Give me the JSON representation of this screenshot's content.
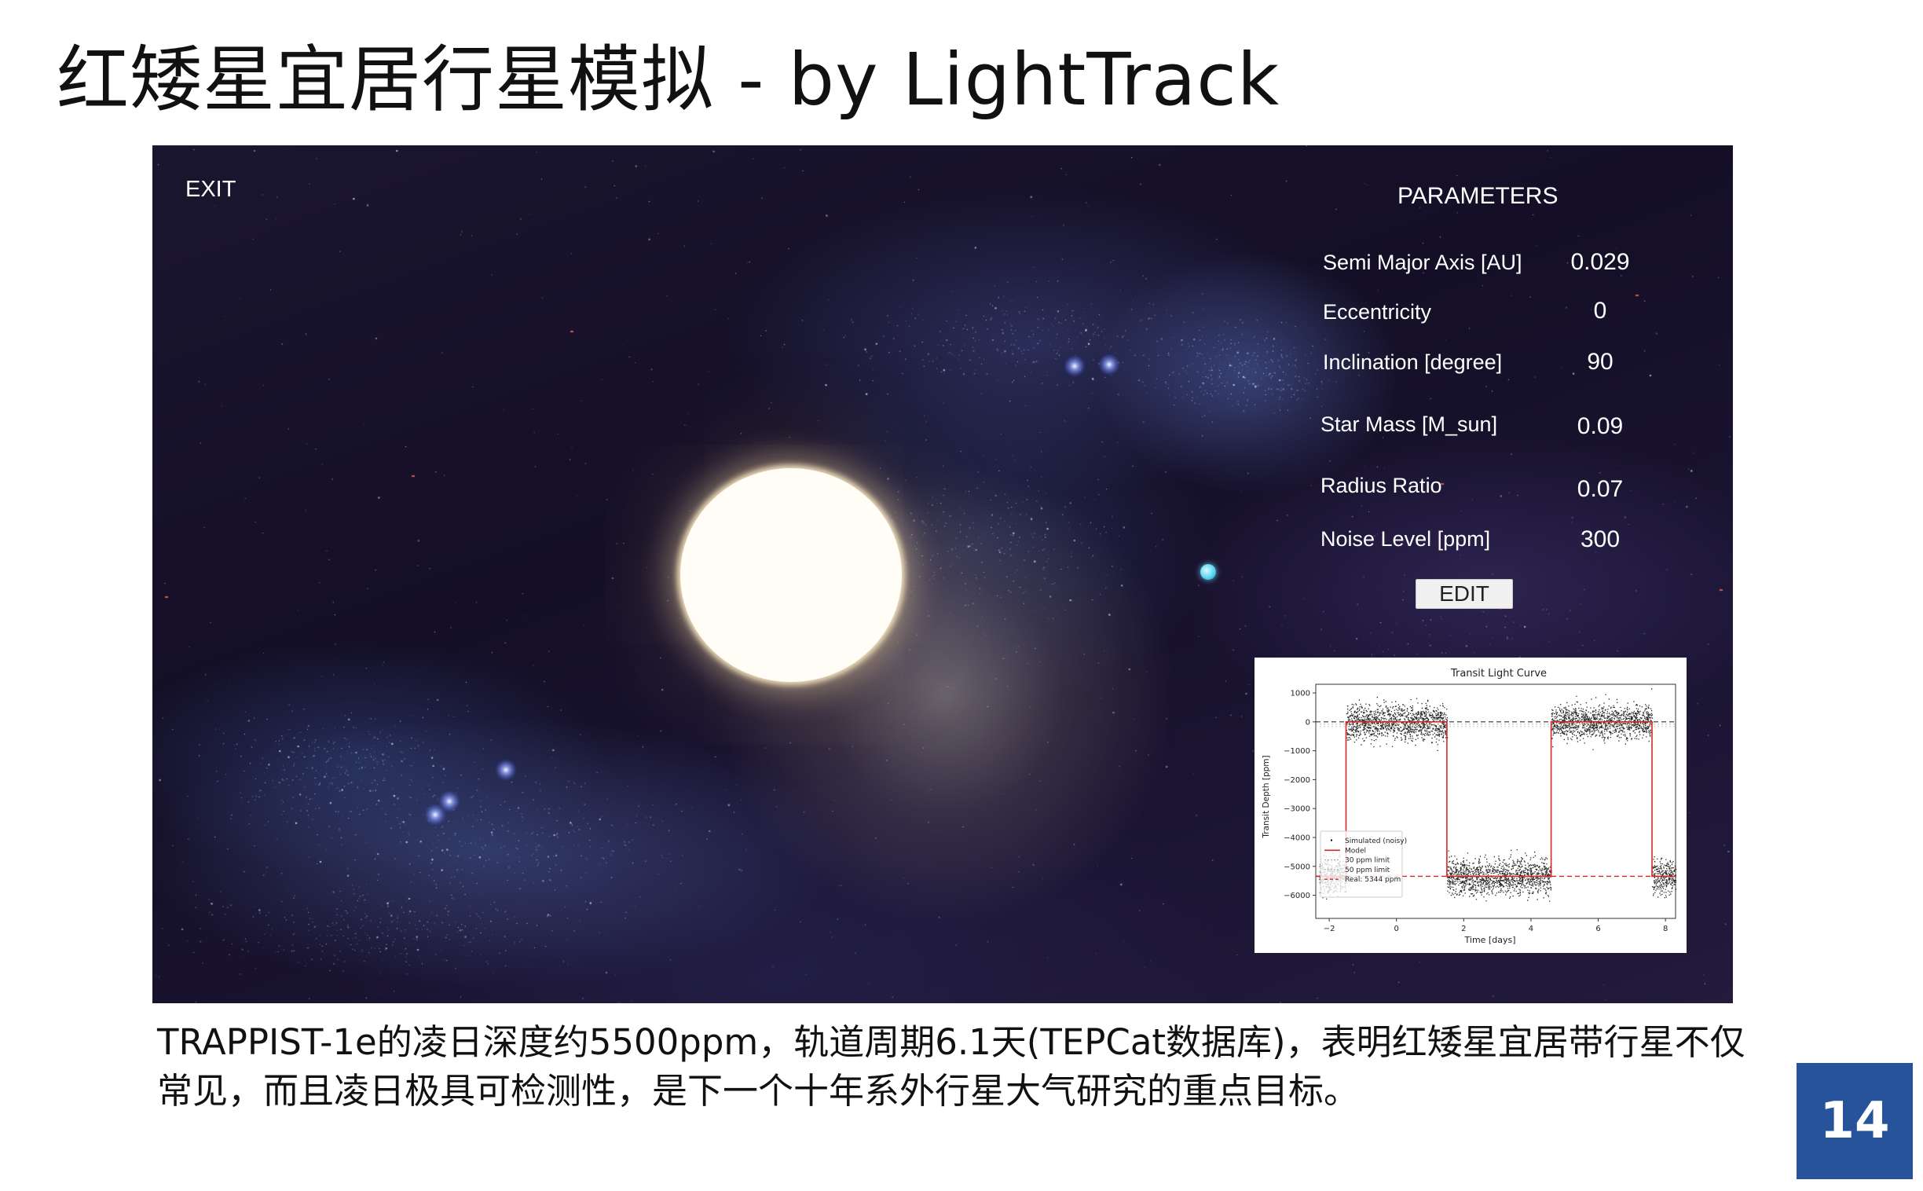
{
  "slide": {
    "title": "红矮星宜居行星模拟 - by LightTrack",
    "caption": "TRAPPIST-1e的凌日深度约5500ppm，轨道周期6.1天(TEPCat数据库)，表明红矮星宜居带行星不仅常见，而且凌日极具可检测性，是下一个十年系外行星大气研究的重点目标。",
    "page_number": "14",
    "accent_color": "#27539a"
  },
  "app": {
    "exit_label": "EXIT",
    "parameters": {
      "title": "PARAMETERS",
      "rows": [
        {
          "label": "Semi Major Axis [AU]",
          "value": "0.029"
        },
        {
          "label": "Eccentricity",
          "value": "0"
        },
        {
          "label": "Inclination [degree]",
          "value": "90"
        },
        {
          "label": "Star Mass [M_sun]",
          "value": "0.09"
        },
        {
          "label": "Radius Ratio",
          "value": "0.07"
        },
        {
          "label": "Noise Level [ppm]",
          "value": "300"
        }
      ],
      "edit_label": "EDIT"
    },
    "scene": {
      "star_color": "#fffdf6",
      "planet_color": "#59d8f0",
      "background_color": "#160f28"
    }
  },
  "chart_data": {
    "type": "line",
    "title": "Transit Light Curve",
    "xlabel": "Time [days]",
    "ylabel": "Transit Depth [ppm]",
    "xlim": [
      -2.4,
      8.3
    ],
    "ylim": [
      -6800,
      1300
    ],
    "xticks": [
      -2,
      0,
      2,
      4,
      6,
      8
    ],
    "yticks": [
      1000,
      0,
      -1000,
      -2000,
      -3000,
      -4000,
      -5000,
      -6000
    ],
    "xtick_labels": [
      "−2",
      "0",
      "2",
      "4",
      "6",
      "8"
    ],
    "ytick_labels": [
      "1000",
      "0",
      "−1000",
      "−2000",
      "−3000",
      "−4000",
      "−5000",
      "−6000"
    ],
    "grid": false,
    "legend_position": "lower-left",
    "series": [
      {
        "name": "Simulated (noisy)",
        "kind": "scatter",
        "color": "#000000",
        "noise_ppm": 300,
        "segments": [
          {
            "x": [
              -2.3,
              -1.5
            ],
            "y": -5344
          },
          {
            "x": [
              -1.5,
              1.5
            ],
            "y": 0
          },
          {
            "x": [
              1.5,
              4.6
            ],
            "y": -5344
          },
          {
            "x": [
              4.6,
              7.6
            ],
            "y": 0
          },
          {
            "x": [
              7.6,
              8.3
            ],
            "y": -5344
          }
        ]
      },
      {
        "name": "Model",
        "kind": "step",
        "color": "#d62728",
        "x": [
          -2.4,
          -1.5,
          -1.5,
          1.5,
          1.5,
          4.6,
          4.6,
          7.6,
          7.6,
          8.3
        ],
        "y": [
          -5344,
          -5344,
          0,
          0,
          -5344,
          -5344,
          0,
          0,
          -5344,
          -5344
        ]
      },
      {
        "name": "30 ppm limit",
        "kind": "hline",
        "color": "#bbbbbb",
        "y": -30
      },
      {
        "name": "50 ppm limit",
        "kind": "hline",
        "color": "#cccccc",
        "y": -50
      },
      {
        "name": "Real: 5344 ppm",
        "kind": "hline-dashed",
        "color": "#d62728",
        "y": -5344
      }
    ],
    "zero_line": {
      "y": 0,
      "color": "#333333",
      "style": "dashed"
    }
  }
}
